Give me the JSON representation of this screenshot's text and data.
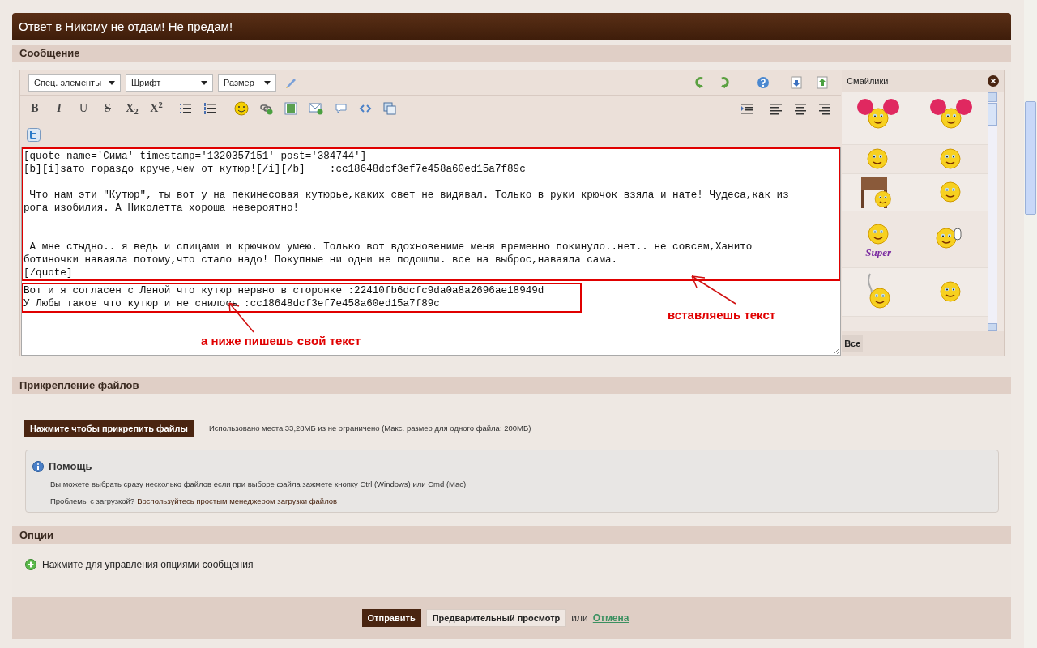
{
  "window": {
    "title": "Ответ в Никому не отдам! Не предам!"
  },
  "message_section": {
    "title": "Сообщение"
  },
  "toolbar": {
    "dropdowns": [
      "Спец. элементы",
      "Шрифт",
      "Размер"
    ],
    "format_buttons": [
      {
        "label": "B",
        "kind": "bold"
      },
      {
        "label": "I",
        "kind": "italic"
      },
      {
        "label": "U",
        "kind": "underline"
      },
      {
        "label": "S",
        "kind": "strike"
      },
      {
        "label": "X$_{2}$",
        "kind": "plain"
      },
      {
        "label": "X$^{2}$",
        "kind": "plain"
      }
    ]
  },
  "editor": {
    "quoted_lines": [
      {
        "kind": "text",
        "text": "[quote name='Сима' timestamp='1320357151' post='384744']"
      },
      {
        "kind": "text",
        "text": "[b][i]зато гораздо круче,чем от кутюр![/i][/b]    :cc18648dcf3ef7e458a60ed15a7f89c"
      },
      {
        "kind": "blank"
      },
      {
        "kind": "text",
        "text": " Что нам эти \"Кутюр\", ты вот у на пекинесовая кутюрье,каких свет не видявал. Только в руки крючок взяла и нате! Чудеса,как из"
      },
      {
        "kind": "text",
        "text": "рога изобилия. А Николетта хороша невероятно!"
      },
      {
        "kind": "blank"
      },
      {
        "kind": "blank"
      },
      {
        "kind": "text",
        "text": " А мне стыдно.. я ведь и спицами и крючком умею. Только вот вдохновениме меня временно покинуло..нет.. не совсем,Ханито"
      },
      {
        "kind": "text",
        "text": "ботиночки наваяла потому,что стало надо! Покупные ни одни не подошли. все на выброс,наваяла сама."
      },
      {
        "kind": "text",
        "text": "[/quote]"
      }
    ],
    "own_lines": [
      {
        "kind": "text",
        "text": "Вот и я согласен с Леной что кутюр нервно в сторонке :22410fb6dcfc9da0a8a2696ae18949d"
      },
      {
        "kind": "text",
        "text": "У Любы такое что кутюр и не снилось :cc18648dcf3ef7e458a60ed15a7f89c"
      }
    ],
    "annotations": [
      "вставляешь текст",
      "а ниже пишешь свой текст"
    ]
  },
  "smilies": {
    "title": "Смайлики",
    "all_button": "Все",
    "items": [
      {
        "kind": "big"
      },
      {
        "kind": "big"
      },
      {
        "kind": "small"
      },
      {
        "kind": "small"
      },
      {
        "kind": "piano"
      },
      {
        "kind": "small"
      },
      {
        "kind": "super",
        "label": "Super"
      },
      {
        "kind": "wave"
      },
      {
        "kind": "smoke"
      },
      {
        "kind": "small"
      }
    ]
  },
  "attachments": {
    "title": "Прикрепление файлов",
    "button": "Нажмите чтобы прикрепить файлы",
    "usage": "Использовано места 33,28МБ из не ограничено (Макс. размер для одного файла: 200МБ)",
    "help": {
      "title": "Помощь",
      "text": "Вы можете выбрать сразу несколько файлов если при выборе файла зажмете кнопку Ctrl (Windows) или Cmd (Mac)",
      "problem": "Проблемы с загрузкой?",
      "link": "Воспользуйтесь простым менеджером загрузки файлов"
    }
  },
  "options": {
    "title": "Опции",
    "toggle": "Нажмите для управления опциями сообщения"
  },
  "footer": {
    "submit": "Отправить",
    "preview": "Предварительный просмотр",
    "or": "или",
    "cancel": "Отмена"
  }
}
